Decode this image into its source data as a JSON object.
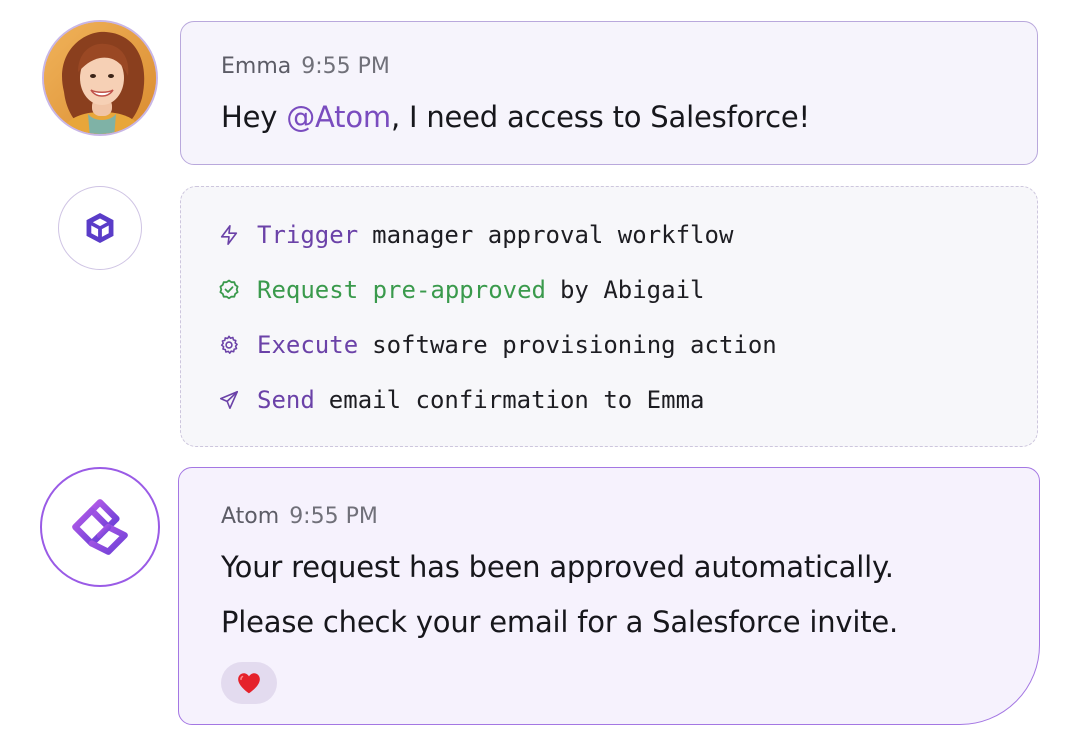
{
  "messages": {
    "user": {
      "sender": "Emma",
      "time": "9:55 PM",
      "text_before": "Hey ",
      "mention": "@Atom",
      "text_after": ", I need access to Salesforce!",
      "avatar": "emma-portrait-avatar"
    },
    "workflow": {
      "avatar_icon": "box-icon",
      "steps": [
        {
          "icon": "lightning-icon",
          "verb": "Trigger",
          "rest": "manager approval workflow",
          "color": "#6b42a8"
        },
        {
          "icon": "check-badge-icon",
          "verb": "Request pre-approved",
          "rest": "by Abigail",
          "color": "#3a9a4c"
        },
        {
          "icon": "gear-icon",
          "verb": "Execute",
          "rest": "software provisioning action",
          "color": "#6b42a8"
        },
        {
          "icon": "send-icon",
          "verb": "Send",
          "rest": "email confirmation to Emma",
          "color": "#6b42a8"
        }
      ]
    },
    "atom": {
      "sender": "Atom",
      "time": "9:55 PM",
      "line1": "Your request has been approved automatically.",
      "line2": "Please check your email for a Salesforce invite.",
      "avatar_icon": "atom-logo-icon",
      "reaction": "❤️"
    }
  },
  "colors": {
    "accent": "#7a4cbf",
    "success": "#3a9a4c",
    "bubble_border": "#b9a8dc",
    "atom_border": "#a477e3"
  }
}
